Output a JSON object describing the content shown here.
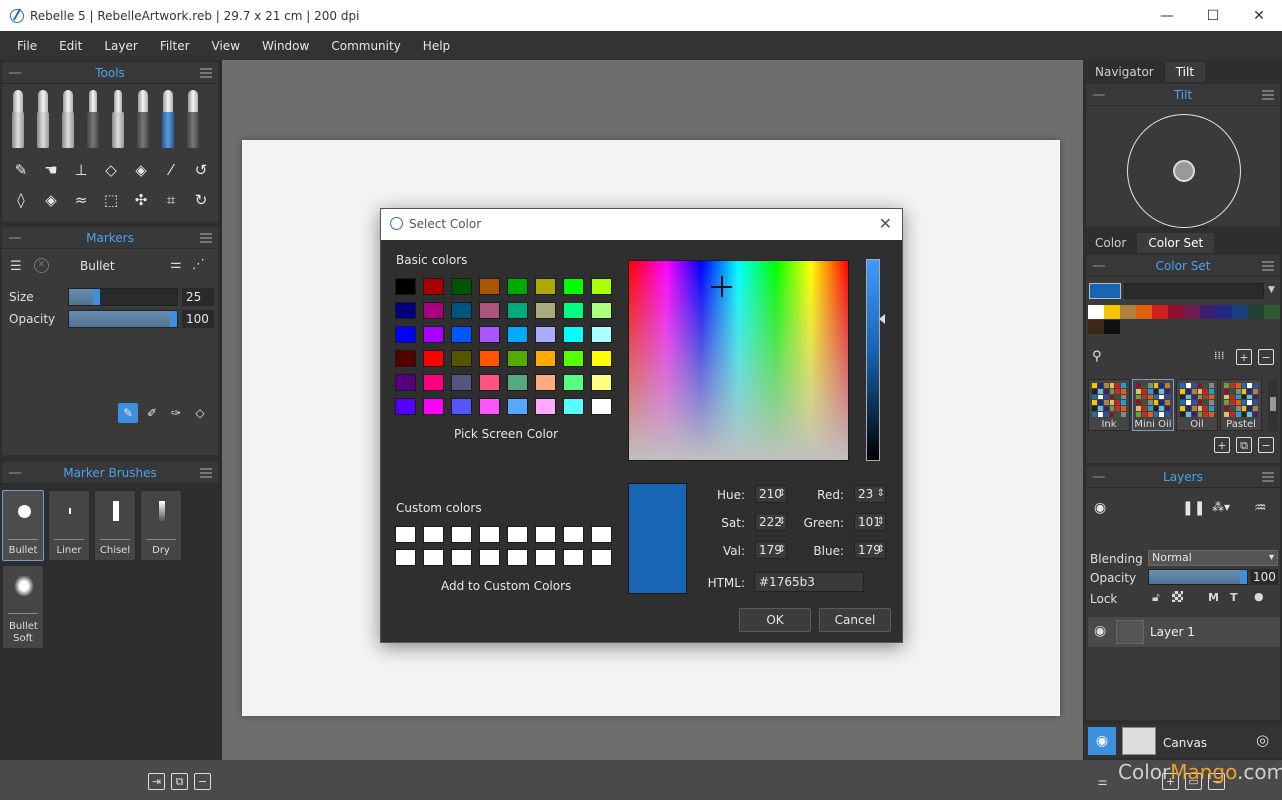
{
  "window": {
    "title": "Rebelle 5 | RebelleArtwork.reb | 29.7 x 21 cm | 200 dpi",
    "controls": [
      "—",
      "☐",
      "✕"
    ]
  },
  "menu": [
    "File",
    "Edit",
    "Layer",
    "Filter",
    "View",
    "Window",
    "Community",
    "Help"
  ],
  "tools_panel": {
    "title": "Tools",
    "tool_icons": [
      "pen-icon",
      "smudge-icon",
      "stamp-icon",
      "eraser-icon",
      "fill-icon",
      "eyedropper-icon",
      "undo-icon",
      "water-drop-icon",
      "blend-icon",
      "blow-icon",
      "selection-icon",
      "transform-icon",
      "crop-icon",
      "redo-icon"
    ]
  },
  "markers_panel": {
    "title": "Markers",
    "brush_name": "Bullet",
    "size_label": "Size",
    "size_value": "25",
    "size_fraction": 0.25,
    "opacity_label": "Opacity",
    "opacity_value": "100",
    "opacity_fraction": 1.0
  },
  "marker_brushes": {
    "title": "Marker Brushes",
    "items": [
      "Bullet",
      "Liner",
      "Chisel",
      "Dry",
      "Bullet Soft"
    ],
    "selected": "Bullet"
  },
  "right_tabs_top": [
    "Navigator",
    "Tilt"
  ],
  "tilt_panel": {
    "title": "Tilt"
  },
  "right_tabs_mid": [
    "Color",
    "Color Set"
  ],
  "color_set": {
    "title": "Color Set",
    "current_color": "#1765b3",
    "row1": [
      "#ffffff",
      "#f5c400",
      "#b08040",
      "#e06010",
      "#d02020",
      "#901030",
      "#702050",
      "#402070",
      "#202880",
      "#1a3f7a",
      "#204030",
      "#305a30"
    ],
    "row2": [
      "#3a2818",
      "#111111"
    ],
    "palettes": [
      "Ink",
      "Mini Oil",
      "Oil",
      "Pastel"
    ],
    "selected_palette": "Mini Oil"
  },
  "layers": {
    "title": "Layers",
    "blending_label": "Blending",
    "blending_value": "Normal",
    "opacity_label": "Opacity",
    "opacity_value": "100",
    "opacity_fraction": 1.0,
    "lock_label": "Lock",
    "layer_name": "Layer 1",
    "canvas_label": "Canvas"
  },
  "dialog": {
    "title": "Select Color",
    "basic_colors_label": "Basic colors",
    "basic_colors": [
      "#000000",
      "#aa0000",
      "#005500",
      "#aa5500",
      "#00aa00",
      "#aaaa00",
      "#00ff00",
      "#aaff00",
      "#00007f",
      "#aa007f",
      "#00557f",
      "#aa557f",
      "#00aa7f",
      "#aaaa7f",
      "#00ff7f",
      "#aaff7f",
      "#0000ff",
      "#aa00ff",
      "#0055ff",
      "#aa55ff",
      "#00aaff",
      "#aaaaff",
      "#00ffff",
      "#aaffff",
      "#550000",
      "#ff0000",
      "#555500",
      "#ff5500",
      "#55aa00",
      "#ffaa00",
      "#55ff00",
      "#ffff00",
      "#55007f",
      "#ff007f",
      "#55557f",
      "#ff557f",
      "#55aa7f",
      "#ffaa7f",
      "#55ff7f",
      "#ffff7f",
      "#5500ff",
      "#ff00ff",
      "#5555ff",
      "#ff55ff",
      "#55aaff",
      "#ffaaff",
      "#55ffff",
      "#ffffff"
    ],
    "pick_screen_label": "Pick Screen Color",
    "custom_colors_label": "Custom colors",
    "add_custom_label": "Add to Custom Colors",
    "hue_label": "Hue:",
    "hue_value": "210",
    "sat_label": "Sat:",
    "sat_value": "222",
    "val_label": "Val:",
    "val_value": "179",
    "red_label": "Red:",
    "red_value": "23",
    "green_label": "Green:",
    "green_value": "101",
    "blue_label": "Blue:",
    "blue_value": "179",
    "html_label": "HTML:",
    "html_value": "#1765b3",
    "ok_label": "OK",
    "cancel_label": "Cancel",
    "preview_color": "#1765b3"
  },
  "watermark": {
    "part1": "Color",
    "part2": "Mango",
    "part3": ".com"
  }
}
